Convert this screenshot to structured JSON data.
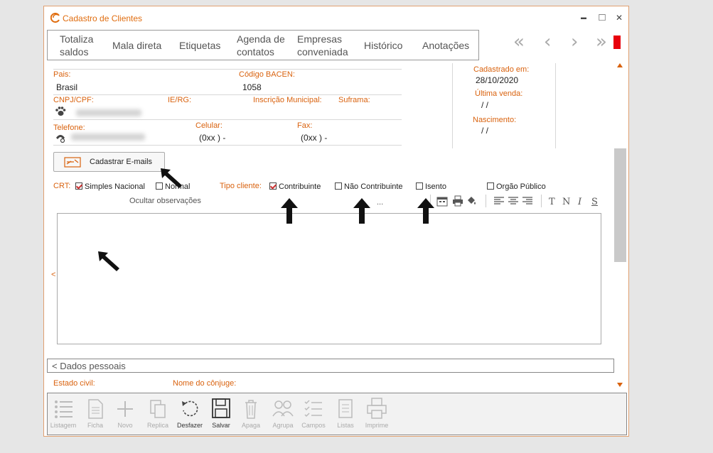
{
  "window": {
    "title": "Cadastro de Clientes"
  },
  "window_controls": {
    "minimize": "▬",
    "maximize": "□",
    "close": "✕"
  },
  "menu": {
    "totaliza_line1": "Totaliza",
    "totaliza_line2": "saldos",
    "mala_direta": "Mala direta",
    "etiquetas": "Etiquetas",
    "agenda_line1": "Agenda de",
    "agenda_line2": "contatos",
    "empresas_line1": "Empresas",
    "empresas_line2": "conveniada",
    "historico": "Histórico",
    "anotacoes": "Anotações"
  },
  "nav": {
    "first": "«",
    "prev": "‹",
    "next": "›",
    "last": "»"
  },
  "fields": {
    "pais_label": "Pais:",
    "pais_value": "Brasil",
    "bacen_label": "Código BACEN:",
    "bacen_value": "1058",
    "cnpj_label": "CNPJ/CPF:",
    "ie_label": "IE/RG:",
    "im_label": "Inscrição Municipal:",
    "suframa_label": "Suframa:",
    "telefone_label": "Telefone:",
    "celular_label": "Celular:",
    "celular_value": "(0xx )  -",
    "fax_label": "Fax:",
    "fax_value": "(0xx )  -",
    "cadastrado_label": "Cadastrado em:",
    "cadastrado_value": "28/10/2020",
    "ultima_venda_label": "Última venda:",
    "ultima_venda_value": "/ /",
    "nascimento_label": "Nascimento:",
    "nascimento_value": "/ /"
  },
  "emails_button": "Cadastrar E-mails",
  "crt": {
    "label": "CRT:",
    "simples": "Simples Nacional",
    "simples_checked": true,
    "normal": "Normal",
    "normal_checked": false
  },
  "tipo_cliente": {
    "label": "Tipo cliente:",
    "contribuinte": "Contribuinte",
    "contribuinte_checked": true,
    "nao_contribuinte": "Não Contribuinte",
    "nao_contribuinte_checked": false,
    "isento": "Isento",
    "isento_checked": false
  },
  "orgao_publico": {
    "label": "Orgão Público",
    "checked": false
  },
  "observacoes": {
    "toggle": "Ocultar observações",
    "ellipsis": "...",
    "collapse": "<"
  },
  "format_toolbar": {
    "bold": "T",
    "normal": "N",
    "italic": "I",
    "strike": "S"
  },
  "section": {
    "dados_pessoais": "< Dados pessoais"
  },
  "personal": {
    "estado_civil_label": "Estado civil:",
    "conjuge_label": "Nome do cônjuge:"
  },
  "bottom_toolbar": {
    "listagem": "Listagem",
    "ficha": "Ficha",
    "novo": "Novo",
    "replica": "Replica",
    "desfazer": "Desfazer",
    "salvar": "Salvar",
    "apaga": "Apaga",
    "agrupa": "Agrupa",
    "campos": "Campos",
    "listas": "Listas",
    "imprime": "Imprime"
  },
  "colors": {
    "accent": "#d9620e",
    "record_indicator": "#e8000d"
  }
}
